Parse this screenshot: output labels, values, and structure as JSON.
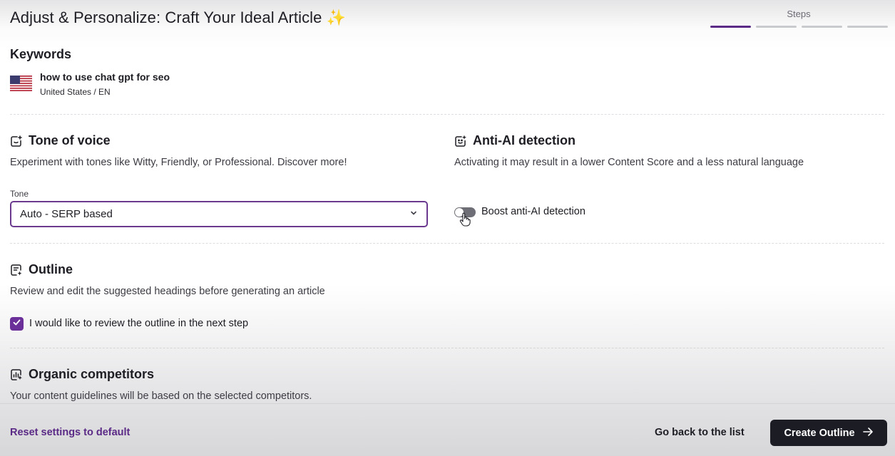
{
  "header": {
    "title": "Adjust & Personalize: Craft Your Ideal Article",
    "title_emoji": "✨",
    "steps_label": "Steps",
    "steps_total": 4,
    "steps_current": 1
  },
  "keywords": {
    "title": "Keywords",
    "flag": "us-flag-icon",
    "keyword": "how to use chat gpt for seo",
    "location": "United States / EN"
  },
  "tone": {
    "title": "Tone of voice",
    "description": "Experiment with tones like Witty, Friendly, or Professional. Discover more!",
    "field_label": "Tone",
    "selected": "Auto - SERP based"
  },
  "anti_ai": {
    "title": "Anti-AI detection",
    "description": "Activating it may result in a lower Content Score and a less natural language",
    "toggle_label": "Boost anti-AI detection",
    "toggle_on": false
  },
  "outline": {
    "title": "Outline",
    "description": "Review and edit the suggested headings before generating an article",
    "checkbox_label": "I would like to review the outline in the next step",
    "checked": true
  },
  "competitors": {
    "title": "Organic competitors",
    "description": "Your content guidelines will be based on the selected competitors."
  },
  "footer": {
    "reset_label": "Reset settings to default",
    "back_label": "Go back to the list",
    "create_label": "Create Outline"
  },
  "colors": {
    "accent": "#6b2f9a",
    "button_dark": "#1b1c24"
  }
}
